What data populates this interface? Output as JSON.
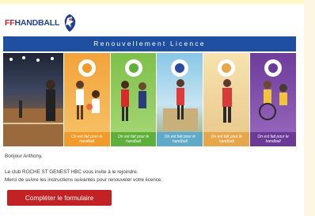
{
  "logo": {
    "ff": "FF",
    "handball": "HANDBALL"
  },
  "banner": {
    "title": "Renouvellement Licence"
  },
  "panels": [
    {
      "name": "arena",
      "tag": ""
    },
    {
      "name": "kids",
      "tag": "On est fait pour le handball"
    },
    {
      "name": "girls",
      "tag": "On est fait pour le handball"
    },
    {
      "name": "outdoor",
      "tag": "On est fait pour le handball"
    },
    {
      "name": "adult",
      "tag": "On est fait pour le handball"
    },
    {
      "name": "wheelchair",
      "tag": "On est fait pour le handball"
    }
  ],
  "colors": {
    "accent_red": "#c32225",
    "brand_blue": "#1f4fa0",
    "panel_tags": [
      "#f39b2a",
      "#5fb03a",
      "#5fa9c9",
      "#e7a64a",
      "#6a3a96"
    ]
  },
  "message": {
    "greeting": "Bonjour Anthony,",
    "line1": "Le club ROCHE ST GENEST HBC vous invite à le rejoindre.",
    "line2": "Merci de suivre les instructions suivantes pour renouveler votre licence."
  },
  "cta": {
    "label": "Compléter le formulaire"
  }
}
